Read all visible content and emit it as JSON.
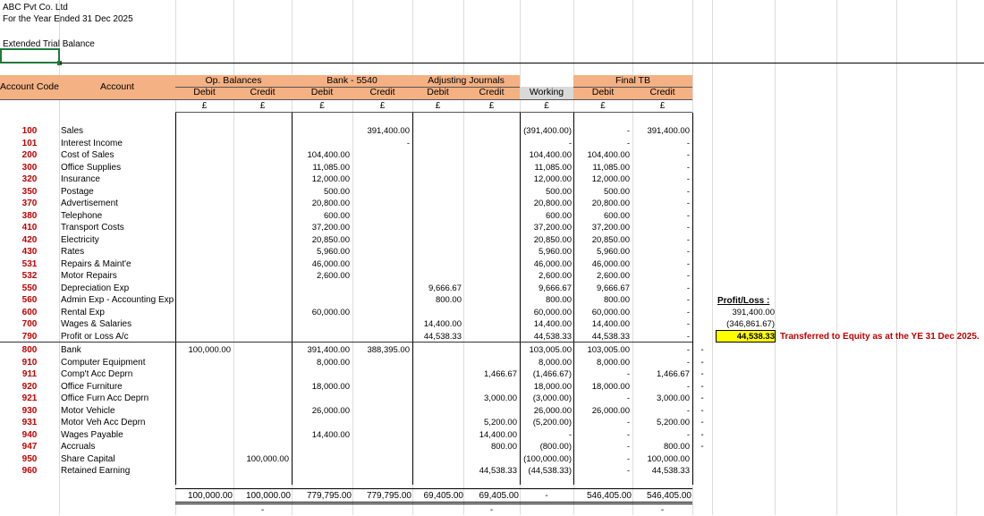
{
  "company": "ABC Pvt Co. Ltd",
  "period": "For the Year Ended 31 Dec 2025",
  "report_title": "Extended Trial Balance",
  "headers": {
    "account_code": "Account Code",
    "account": "Account",
    "groups": [
      "Op. Balances",
      "Bank - 5540",
      "Adjusting Journals",
      "Final TB"
    ],
    "debit": "Debit",
    "credit": "Credit",
    "working": "Working",
    "currency": "£"
  },
  "rows": [
    {
      "code": "100",
      "name": "Sales",
      "op_dr": "",
      "op_cr": "",
      "bk_dr": "",
      "bk_cr": "391,400.00",
      "aj_dr": "",
      "aj_cr": "",
      "wk": "(391,400.00)",
      "f_dr": "-",
      "f_cr": "391,400.00",
      "x": ""
    },
    {
      "code": "101",
      "name": "Interest Income",
      "op_dr": "",
      "op_cr": "",
      "bk_dr": "",
      "bk_cr": "-",
      "aj_dr": "",
      "aj_cr": "",
      "wk": "-",
      "f_dr": "-",
      "f_cr": "-",
      "x": ""
    },
    {
      "code": "200",
      "name": "Cost of Sales",
      "op_dr": "",
      "op_cr": "",
      "bk_dr": "104,400.00",
      "bk_cr": "",
      "aj_dr": "",
      "aj_cr": "",
      "wk": "104,400.00",
      "f_dr": "104,400.00",
      "f_cr": "-",
      "x": ""
    },
    {
      "code": "300",
      "name": "Office Supplies",
      "op_dr": "",
      "op_cr": "",
      "bk_dr": "11,085.00",
      "bk_cr": "",
      "aj_dr": "",
      "aj_cr": "",
      "wk": "11,085.00",
      "f_dr": "11,085.00",
      "f_cr": "-",
      "x": ""
    },
    {
      "code": "320",
      "name": "Insurance",
      "op_dr": "",
      "op_cr": "",
      "bk_dr": "12,000.00",
      "bk_cr": "",
      "aj_dr": "",
      "aj_cr": "",
      "wk": "12,000.00",
      "f_dr": "12,000.00",
      "f_cr": "-",
      "x": ""
    },
    {
      "code": "350",
      "name": "Postage",
      "op_dr": "",
      "op_cr": "",
      "bk_dr": "500.00",
      "bk_cr": "",
      "aj_dr": "",
      "aj_cr": "",
      "wk": "500.00",
      "f_dr": "500.00",
      "f_cr": "-",
      "x": ""
    },
    {
      "code": "370",
      "name": "Advertisement",
      "op_dr": "",
      "op_cr": "",
      "bk_dr": "20,800.00",
      "bk_cr": "",
      "aj_dr": "",
      "aj_cr": "",
      "wk": "20,800.00",
      "f_dr": "20,800.00",
      "f_cr": "-",
      "x": ""
    },
    {
      "code": "380",
      "name": "Telephone",
      "op_dr": "",
      "op_cr": "",
      "bk_dr": "600.00",
      "bk_cr": "",
      "aj_dr": "",
      "aj_cr": "",
      "wk": "600.00",
      "f_dr": "600.00",
      "f_cr": "-",
      "x": ""
    },
    {
      "code": "410",
      "name": "Transport Costs",
      "op_dr": "",
      "op_cr": "",
      "bk_dr": "37,200.00",
      "bk_cr": "",
      "aj_dr": "",
      "aj_cr": "",
      "wk": "37,200.00",
      "f_dr": "37,200.00",
      "f_cr": "-",
      "x": ""
    },
    {
      "code": "420",
      "name": "Electricity",
      "op_dr": "",
      "op_cr": "",
      "bk_dr": "20,850.00",
      "bk_cr": "",
      "aj_dr": "",
      "aj_cr": "",
      "wk": "20,850.00",
      "f_dr": "20,850.00",
      "f_cr": "-",
      "x": ""
    },
    {
      "code": "430",
      "name": "Rates",
      "op_dr": "",
      "op_cr": "",
      "bk_dr": "5,960.00",
      "bk_cr": "",
      "aj_dr": "",
      "aj_cr": "",
      "wk": "5,960.00",
      "f_dr": "5,960.00",
      "f_cr": "-",
      "x": ""
    },
    {
      "code": "531",
      "name": "Repairs & Maint'e",
      "op_dr": "",
      "op_cr": "",
      "bk_dr": "46,000.00",
      "bk_cr": "",
      "aj_dr": "",
      "aj_cr": "",
      "wk": "46,000.00",
      "f_dr": "46,000.00",
      "f_cr": "-",
      "x": ""
    },
    {
      "code": "532",
      "name": "Motor Repairs",
      "op_dr": "",
      "op_cr": "",
      "bk_dr": "2,600.00",
      "bk_cr": "",
      "aj_dr": "",
      "aj_cr": "",
      "wk": "2,600.00",
      "f_dr": "2,600.00",
      "f_cr": "-",
      "x": ""
    },
    {
      "code": "550",
      "name": "Depreciation Exp",
      "op_dr": "",
      "op_cr": "",
      "bk_dr": "",
      "bk_cr": "",
      "aj_dr": "9,666.67",
      "aj_cr": "",
      "wk": "9,666.67",
      "f_dr": "9,666.67",
      "f_cr": "-",
      "x": ""
    },
    {
      "code": "560",
      "name": "Admin Exp - Accounting Exp",
      "op_dr": "",
      "op_cr": "",
      "bk_dr": "",
      "bk_cr": "",
      "aj_dr": "800.00",
      "aj_cr": "",
      "wk": "800.00",
      "f_dr": "800.00",
      "f_cr": "-",
      "x": ""
    },
    {
      "code": "600",
      "name": "Rental Exp",
      "op_dr": "",
      "op_cr": "",
      "bk_dr": "60,000.00",
      "bk_cr": "",
      "aj_dr": "",
      "aj_cr": "",
      "wk": "60,000.00",
      "f_dr": "60,000.00",
      "f_cr": "-",
      "x": ""
    },
    {
      "code": "700",
      "name": "Wages & Salaries",
      "op_dr": "",
      "op_cr": "",
      "bk_dr": "",
      "bk_cr": "",
      "aj_dr": "14,400.00",
      "aj_cr": "",
      "wk": "14,400.00",
      "f_dr": "14,400.00",
      "f_cr": "-",
      "x": ""
    },
    {
      "code": "790",
      "name": "Profit or Loss A/c",
      "op_dr": "",
      "op_cr": "",
      "bk_dr": "",
      "bk_cr": "",
      "aj_dr": "44,538.33",
      "aj_cr": "",
      "wk": "44,538.33",
      "f_dr": "44,538.33",
      "f_cr": "-",
      "x": ""
    },
    {
      "code": "800",
      "name": "Bank",
      "op_dr": "100,000.00",
      "op_cr": "",
      "bk_dr": "391,400.00",
      "bk_cr": "388,395.00",
      "aj_dr": "",
      "aj_cr": "",
      "wk": "103,005.00",
      "f_dr": "103,005.00",
      "f_cr": "-",
      "x": "-"
    },
    {
      "code": "910",
      "name": "Computer Equipment",
      "op_dr": "",
      "op_cr": "",
      "bk_dr": "8,000.00",
      "bk_cr": "",
      "aj_dr": "",
      "aj_cr": "",
      "wk": "8,000.00",
      "f_dr": "8,000.00",
      "f_cr": "-",
      "x": "-"
    },
    {
      "code": "911",
      "name": "Comp't Acc Deprn",
      "op_dr": "",
      "op_cr": "",
      "bk_dr": "",
      "bk_cr": "",
      "aj_dr": "",
      "aj_cr": "1,466.67",
      "wk": "(1,466.67)",
      "f_dr": "-",
      "f_cr": "1,466.67",
      "x": "-"
    },
    {
      "code": "920",
      "name": "Office Furniture",
      "op_dr": "",
      "op_cr": "",
      "bk_dr": "18,000.00",
      "bk_cr": "",
      "aj_dr": "",
      "aj_cr": "",
      "wk": "18,000.00",
      "f_dr": "18,000.00",
      "f_cr": "-",
      "x": "-"
    },
    {
      "code": "921",
      "name": "Office Furn Acc Deprn",
      "op_dr": "",
      "op_cr": "",
      "bk_dr": "",
      "bk_cr": "",
      "aj_dr": "",
      "aj_cr": "3,000.00",
      "wk": "(3,000.00)",
      "f_dr": "-",
      "f_cr": "3,000.00",
      "x": "-"
    },
    {
      "code": "930",
      "name": "Motor Vehicle",
      "op_dr": "",
      "op_cr": "",
      "bk_dr": "26,000.00",
      "bk_cr": "",
      "aj_dr": "",
      "aj_cr": "",
      "wk": "26,000.00",
      "f_dr": "26,000.00",
      "f_cr": "-",
      "x": "-"
    },
    {
      "code": "931",
      "name": "Motor Veh Acc Deprn",
      "op_dr": "",
      "op_cr": "",
      "bk_dr": "",
      "bk_cr": "",
      "aj_dr": "",
      "aj_cr": "5,200.00",
      "wk": "(5,200.00)",
      "f_dr": "-",
      "f_cr": "5,200.00",
      "x": "-"
    },
    {
      "code": "940",
      "name": "Wages Payable",
      "op_dr": "",
      "op_cr": "",
      "bk_dr": "14,400.00",
      "bk_cr": "",
      "aj_dr": "",
      "aj_cr": "14,400.00",
      "wk": "-",
      "f_dr": "-",
      "f_cr": "-",
      "x": "-"
    },
    {
      "code": "947",
      "name": "Accruals",
      "op_dr": "",
      "op_cr": "",
      "bk_dr": "",
      "bk_cr": "",
      "aj_dr": "",
      "aj_cr": "800.00",
      "wk": "(800.00)",
      "f_dr": "-",
      "f_cr": "800.00",
      "x": "-"
    },
    {
      "code": "950",
      "name": "Share Capital",
      "op_dr": "",
      "op_cr": "100,000.00",
      "bk_dr": "",
      "bk_cr": "",
      "aj_dr": "",
      "aj_cr": "",
      "wk": "(100,000.00)",
      "f_dr": "-",
      "f_cr": "100,000.00",
      "x": ""
    },
    {
      "code": "960",
      "name": "Retained Earning",
      "op_dr": "",
      "op_cr": "",
      "bk_dr": "",
      "bk_cr": "",
      "aj_dr": "",
      "aj_cr": "44,538.33",
      "wk": "(44,538.33)",
      "f_dr": "-",
      "f_cr": "44,538.33",
      "x": ""
    }
  ],
  "totals": {
    "op_dr": "100,000.00",
    "op_cr": "100,000.00",
    "bk_dr": "779,795.00",
    "bk_cr": "779,795.00",
    "aj_dr": "69,405.00",
    "aj_cr": "69,405.00",
    "wk": "-",
    "f_dr": "546,405.00",
    "f_cr": "546,405.00"
  },
  "below_totals": {
    "op_cr": "-",
    "aj_cr": "-",
    "f_cr": "-"
  },
  "profit_loss": {
    "label": "Profit/Loss :",
    "income": "391,400.00",
    "expenses": "(346,861.67)",
    "result": "44,538.33",
    "note": "Transferred to Equity as at the YE 31 Dec 2025."
  }
}
